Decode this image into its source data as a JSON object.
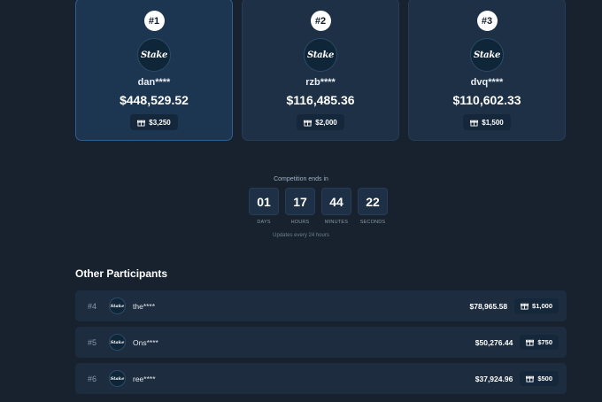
{
  "podium": [
    {
      "rank": "#1",
      "name": "dan****",
      "amount": "$448,529.52",
      "prize": "$3,250",
      "logo": "Stake"
    },
    {
      "rank": "#2",
      "name": "rzb****",
      "amount": "$116,485.36",
      "prize": "$2,000",
      "logo": "Stake"
    },
    {
      "rank": "#3",
      "name": "dvq****",
      "amount": "$110,602.33",
      "prize": "$1,500",
      "logo": "Stake"
    }
  ],
  "countdown": {
    "label": "Competition ends in",
    "days": "01",
    "days_label": "DAYS",
    "hours": "17",
    "hours_label": "HOURS",
    "minutes": "44",
    "minutes_label": "MINUTES",
    "seconds": "22",
    "seconds_label": "SECONDS",
    "updates_note": "Updates every 24 hours"
  },
  "participants": {
    "title": "Other Participants",
    "rows": [
      {
        "rank": "#4",
        "name": "the****",
        "amount": "$78,965.58",
        "prize": "$1,000",
        "logo": "Stake"
      },
      {
        "rank": "#5",
        "name": "Ons****",
        "amount": "$50,276.44",
        "prize": "$750",
        "logo": "Stake"
      },
      {
        "rank": "#6",
        "name": "ree****",
        "amount": "$37,924.96",
        "prize": "$500",
        "logo": "Stake"
      }
    ]
  },
  "icons": {
    "prize": "gift-icon",
    "logo": "stake-logo"
  },
  "colors": {
    "background": "#18222e",
    "card": "#1d3045",
    "highlight_border": "#2f5f8e",
    "row": "#1d2d3f"
  }
}
